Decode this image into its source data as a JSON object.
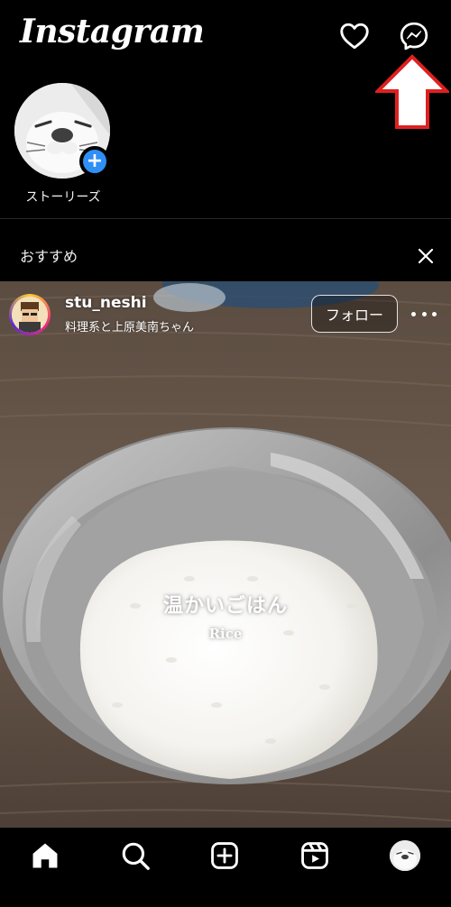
{
  "header": {
    "logo_text": "Instagram",
    "notifications_icon": "heart-icon",
    "messenger_icon": "messenger-icon",
    "annotation_icon": "red-up-arrow-icon"
  },
  "stories": {
    "own_story_label": "ストーリーズ",
    "add_icon": "plus-icon"
  },
  "recommended": {
    "label": "おすすめ",
    "close_icon": "close-icon"
  },
  "post": {
    "username": "stu_neshi",
    "subtitle": "料理系と上原美南ちゃん",
    "follow_label": "フォロー",
    "more_icon": "more-horizontal-icon",
    "caption_ja": "温かいごはん",
    "caption_en": "Rice"
  },
  "bottom_nav": {
    "items": [
      {
        "icon": "home-icon"
      },
      {
        "icon": "search-icon"
      },
      {
        "icon": "add-post-icon"
      },
      {
        "icon": "reels-icon"
      },
      {
        "icon": "profile-avatar-icon"
      }
    ]
  },
  "colors": {
    "background": "#000000",
    "accent_blue": "#2f8ff5",
    "annotation_red": "#e02020"
  }
}
